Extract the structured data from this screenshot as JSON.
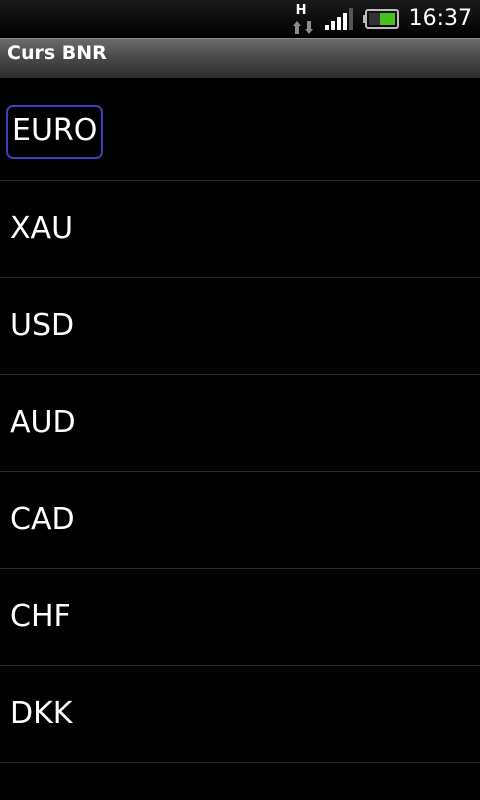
{
  "status_bar": {
    "network_type": "H",
    "time": "16:37"
  },
  "title_bar": {
    "title": "Curs BNR"
  },
  "currencies": [
    "EURO",
    "XAU",
    "USD",
    "AUD",
    "CAD",
    "CHF",
    "DKK"
  ],
  "focused_index": 0,
  "icons": {
    "network": "data-updown-icon",
    "signal": "signal-strength-icon",
    "battery": "battery-icon"
  },
  "colors": {
    "background": "#000000",
    "focus_border": "#3f3fb8",
    "battery_level": "#46c21e"
  }
}
